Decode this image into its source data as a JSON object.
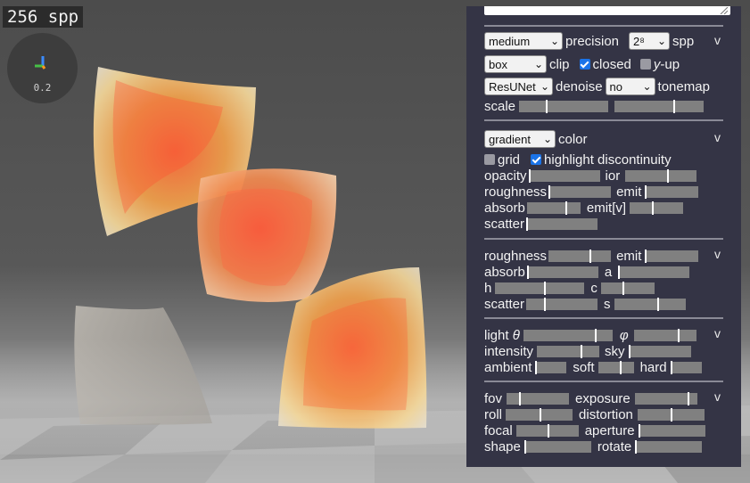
{
  "render": {
    "spp_label": "256 spp",
    "axes_scale": "0.2"
  },
  "panel": {
    "quality": {
      "selected": "medium",
      "label": "precision"
    },
    "spp": {
      "selected": "2⁸",
      "label": "spp"
    },
    "toggle": "v",
    "clip": {
      "selected": "box",
      "label": "clip"
    },
    "closed": {
      "label": "closed",
      "checked": true
    },
    "yup": {
      "label_italic": "y",
      "label_rest": "-up",
      "checked": false
    },
    "denoiser": {
      "selected": "ResUNet",
      "label": "denoise"
    },
    "tonemap": {
      "selected": "no",
      "label": "tonemap"
    },
    "scale": {
      "label": "scale",
      "levels": [
        0.3,
        0.66
      ]
    },
    "color": {
      "selected": "gradient",
      "label": "color"
    },
    "grid": {
      "label": "grid",
      "checked": false
    },
    "highlight": {
      "label": "highlight discontinuity",
      "checked": true
    },
    "material": {
      "opacity": {
        "label": "opacity",
        "level": 0.0
      },
      "ior": {
        "label": "ior",
        "level": 0.58
      },
      "roughness": {
        "label": "roughness",
        "level": 0.0
      },
      "emit": {
        "label": "emit",
        "level": 0.0
      },
      "absorb": {
        "label": "absorb",
        "level": 0.72
      },
      "emit_v": {
        "label": "emit[v]",
        "level": 0.42
      },
      "scatter": {
        "label": "scatter",
        "level": 0.0
      }
    },
    "medium": {
      "roughness": {
        "label": "roughness",
        "level": 0.66
      },
      "emit": {
        "label": "emit",
        "level": 0.0
      },
      "absorb": {
        "label": "absorb",
        "level": 0.0
      },
      "a": {
        "label": "a",
        "level": 0.0
      },
      "h": {
        "label": "h",
        "level": 0.55
      },
      "c": {
        "label": "c",
        "level": 0.4
      },
      "scatter": {
        "label": "scatter",
        "level": 0.25
      },
      "s": {
        "label": "s",
        "level": 0.6
      }
    },
    "light": {
      "theta": {
        "label": "light",
        "symbol": "θ",
        "level": 0.8
      },
      "phi": {
        "label": "",
        "symbol": "φ",
        "level": 0.7
      },
      "intensity": {
        "label": "intensity",
        "level": 0.7
      },
      "sky": {
        "label": "sky",
        "level": 0.0
      },
      "ambient": {
        "label": "ambient",
        "level": 0.0
      },
      "soft": {
        "label": "soft",
        "level": 0.6
      },
      "hard": {
        "label": "hard",
        "level": 0.0
      }
    },
    "camera": {
      "fov": {
        "label": "fov",
        "level": 0.2
      },
      "exposure": {
        "label": "exposure",
        "level": 0.85
      },
      "roll": {
        "label": "roll",
        "level": 0.5
      },
      "distortion": {
        "label": "distortion",
        "level": 0.5
      },
      "focal": {
        "label": "focal",
        "level": 0.5
      },
      "aperture": {
        "label": "aperture",
        "level": 0.0
      },
      "shape": {
        "label": "shape",
        "level": 0.0
      },
      "rotate": {
        "label": "rotate",
        "level": 0.0
      }
    }
  }
}
